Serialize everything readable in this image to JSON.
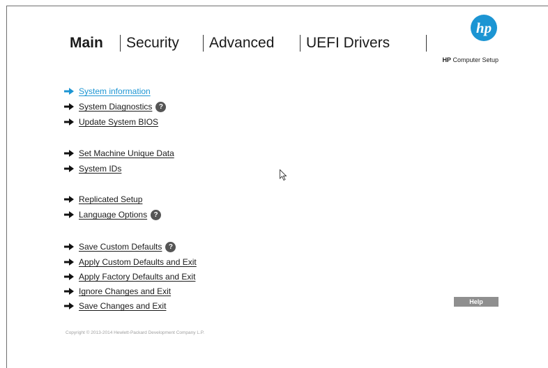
{
  "tabs": [
    {
      "label": "Main"
    },
    {
      "label": "Security"
    },
    {
      "label": "Advanced"
    },
    {
      "label": "UEFI Drivers"
    }
  ],
  "brand": {
    "logo": "hp",
    "subtitle_bold": "HP",
    "subtitle_rest": " Computer Setup",
    "color": "#1c95d3"
  },
  "menu": {
    "items": [
      {
        "label": "System information"
      },
      {
        "label": "System Diagnostics"
      },
      {
        "label": "Update System BIOS"
      },
      {
        "label": "Set Machine Unique Data"
      },
      {
        "label": "System IDs"
      },
      {
        "label": "Replicated Setup"
      },
      {
        "label": "Language Options"
      },
      {
        "label": "Save Custom Defaults"
      },
      {
        "label": "Apply Custom Defaults and Exit"
      },
      {
        "label": "Apply Factory Defaults and Exit"
      },
      {
        "label": "Ignore Changes and Exit"
      },
      {
        "label": "Save Changes and Exit"
      }
    ],
    "help_mark": "?"
  },
  "help_button": {
    "label": "Help"
  },
  "copyright": "Copyright © 2013-2014 Hewlett-Packard Development Company L.P."
}
